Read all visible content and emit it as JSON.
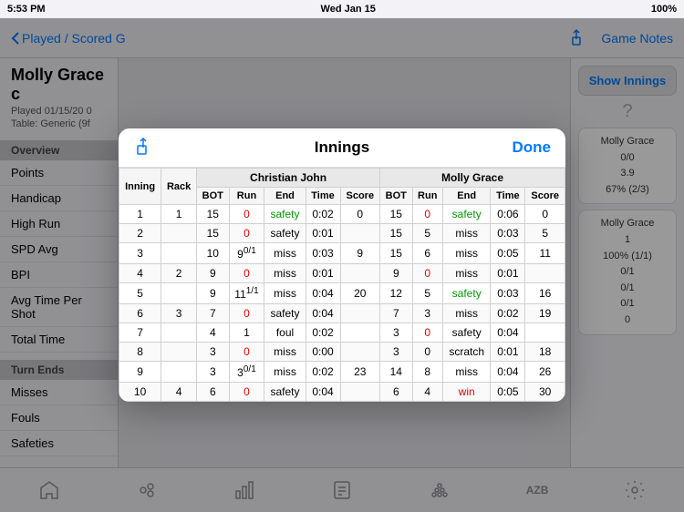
{
  "statusBar": {
    "time": "5:53 PM",
    "date": "Wed Jan 15",
    "battery": "100%"
  },
  "navBar": {
    "backLabel": "Played / Scored G",
    "rightLabel": "Game Notes"
  },
  "pageTitle": "Molly Grace c",
  "pageSubtitle1": "Played 01/15/20 0",
  "pageSubtitle2": "Table: Generic (9f",
  "sidebar": {
    "overviewSection": "Overview",
    "items": [
      {
        "label": "Points"
      },
      {
        "label": "Handicap"
      },
      {
        "label": "High Run"
      },
      {
        "label": "SPD Avg"
      },
      {
        "label": "BPI"
      },
      {
        "label": "Avg Time Per Shot"
      },
      {
        "label": "Total Time"
      }
    ],
    "turnEndsSection": "Turn Ends",
    "turnItems": [
      {
        "label": "Misses"
      },
      {
        "label": "Fouls"
      },
      {
        "label": "Safeties"
      }
    ]
  },
  "rightPanel": {
    "showInningsBtn": "Show Innings",
    "questionMark": "?",
    "box1": {
      "name": "Molly Grace",
      "line1": "0/0",
      "line2": "3.9",
      "line3": "67% (2/3)"
    },
    "box2": {
      "name": "Molly Grace",
      "line1": "1",
      "line2": "100% (1/1)",
      "line3": "0/1",
      "line4": "0/1",
      "line5": "0/1",
      "line6": "0"
    }
  },
  "modal": {
    "title": "Innings",
    "doneLabel": "Done",
    "tableHeaders": {
      "inning": "Inning",
      "rack": "Rack",
      "christianJohn": "Christian John",
      "mollyGrace": "Molly Grace",
      "bot": "BOT",
      "run": "Run",
      "end": "End",
      "time": "Time",
      "score": "Score"
    },
    "rows": [
      {
        "inning": "1",
        "rack": "1",
        "cj_bot": "15",
        "cj_run_red": "0",
        "cj_end": "safety",
        "cj_end_green": true,
        "cj_time": "0:02",
        "cj_score": "0",
        "mg_bot": "15",
        "mg_run_red": "0",
        "mg_end": "safety",
        "mg_end_green": true,
        "mg_time": "0:06",
        "mg_score": "0"
      },
      {
        "inning": "2",
        "rack": "",
        "cj_bot": "15",
        "cj_run_red": "0",
        "cj_end": "safety",
        "cj_end_green": false,
        "cj_time": "0:01",
        "cj_score": "",
        "mg_bot": "15",
        "mg_run": "5",
        "mg_end": "miss",
        "mg_end_green": false,
        "mg_time": "0:03",
        "mg_score": "5"
      },
      {
        "inning": "3",
        "rack": "",
        "cj_bot": "10",
        "cj_run": "9",
        "cj_run_sup": "0/1",
        "cj_end": "miss",
        "cj_time": "0:03",
        "cj_score": "9",
        "mg_bot": "15",
        "mg_run": "6",
        "mg_end": "miss",
        "mg_time": "0:05",
        "mg_score": "11"
      },
      {
        "inning": "4",
        "rack": "2",
        "cj_bot": "9",
        "cj_run_red": "0",
        "cj_end": "miss",
        "cj_time": "0:01",
        "cj_score": "",
        "mg_bot": "9",
        "mg_run_red": "0",
        "mg_end": "miss",
        "mg_time": "0:01",
        "mg_score": ""
      },
      {
        "inning": "5",
        "rack": "",
        "cj_bot": "9",
        "cj_run": "11",
        "cj_run_sup": "1/1",
        "cj_end": "miss",
        "cj_time": "0:04",
        "cj_score": "20",
        "mg_bot": "12",
        "mg_run": "5",
        "mg_end": "safety",
        "mg_end_green": true,
        "mg_time": "0:03",
        "mg_score": "16"
      },
      {
        "inning": "6",
        "rack": "3",
        "cj_bot": "7",
        "cj_run_red": "0",
        "cj_end": "safety",
        "cj_time": "0:04",
        "cj_score": "",
        "mg_bot": "7",
        "mg_run": "3",
        "mg_end": "miss",
        "mg_time": "0:02",
        "mg_score": "19"
      },
      {
        "inning": "7",
        "rack": "",
        "cj_bot": "4",
        "cj_run": "1",
        "cj_end": "foul",
        "cj_time": "0:02",
        "cj_score": "",
        "mg_bot": "3",
        "mg_run_red": "0",
        "mg_end": "safety",
        "mg_time": "0:04",
        "mg_score": ""
      },
      {
        "inning": "8",
        "rack": "",
        "cj_bot": "3",
        "cj_run_red": "0",
        "cj_end": "miss",
        "cj_time": "0:00",
        "cj_score": "",
        "mg_bot": "3",
        "mg_run": "0",
        "mg_end": "scratch",
        "mg_time": "0:01",
        "mg_score": "18"
      },
      {
        "inning": "9",
        "rack": "",
        "cj_bot": "3",
        "cj_run": "3",
        "cj_run_sup": "0/1",
        "cj_end": "miss",
        "cj_time": "0:02",
        "cj_score": "23",
        "mg_bot": "14",
        "mg_run": "8",
        "mg_end": "miss",
        "mg_time": "0:04",
        "mg_score": "26"
      },
      {
        "inning": "10",
        "rack": "4",
        "cj_bot": "6",
        "cj_run_red": "0",
        "cj_end": "safety",
        "cj_time": "0:04",
        "cj_score": "",
        "mg_bot": "6",
        "mg_run": "4",
        "mg_end": "win",
        "mg_end_red": true,
        "mg_time": "0:05",
        "mg_score": "30"
      }
    ]
  },
  "tabBar": {
    "tabs": [
      "home",
      "billiards",
      "stats",
      "scorecard",
      "rack",
      "azb",
      "settings"
    ]
  }
}
